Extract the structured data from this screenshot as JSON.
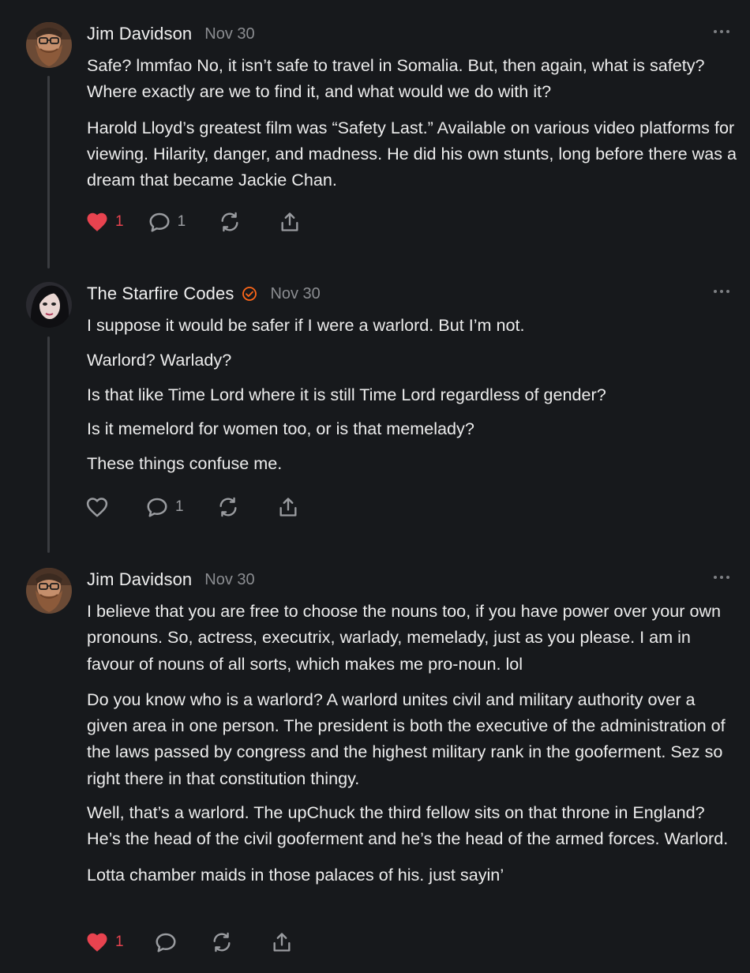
{
  "comments": [
    {
      "author": "Jim Davidson",
      "date": "Nov 30",
      "avatar": "bearded-man-avatar",
      "verified": false,
      "paragraphs": [
        "Safe? lmmfao No, it isn’t safe to travel in Somalia. But, then again, what is safety? Where exactly are we to find it, and what would we do with it?",
        "Harold Lloyd’s greatest film was “Safety Last.” Available on various video platforms for viewing. Hilarity, danger, and madness. He did his own stunts, long before there was a dream that became Jackie Chan."
      ],
      "like_count": "1",
      "liked": true,
      "reply_count": "1"
    },
    {
      "author": "The Starfire Codes",
      "date": "Nov 30",
      "avatar": "woman-avatar",
      "verified": true,
      "paragraphs": [
        "I suppose it would be safer if I were a warlord. But I’m not.",
        "Warlord? Warlady?",
        "Is that like Time Lord where it is still Time Lord regardless of gender?",
        "Is it memelord for women too, or is that memelady?",
        "These things confuse me."
      ],
      "like_count": "",
      "liked": false,
      "reply_count": "1"
    },
    {
      "author": "Jim Davidson",
      "date": "Nov 30",
      "avatar": "bearded-man-avatar",
      "verified": false,
      "paragraphs": [
        "I believe that you are free to choose the nouns too, if you have power over your own pronouns. So, actress, executrix, warlady, memelady, just as you please. I am in favour of nouns of all sorts, which makes me pro-noun. lol",
        "Do you know who is a warlord? A warlord unites civil and military authority over a given area in one person. The president is both the executive of the administration of the laws passed by congress and the highest military rank in the gooferment. Sez so right there in that constitution thingy.",
        "Well, that’s a warlord. The upChuck the third fellow sits on that throne in England? He’s the head of the civil gooferment and he’s the head of the armed forces. Warlord.",
        "Lotta chamber maids in those palaces of his. just sayin’"
      ],
      "like_count": "1",
      "liked": true,
      "reply_count": ""
    }
  ],
  "colors": {
    "background": "#17191c",
    "text": "#ececec",
    "muted": "#8b8d91",
    "like_red": "#e8434f",
    "verified_orange": "#ff6719",
    "thread_line": "#3a3c40"
  },
  "icons": {
    "like": "heart-icon",
    "reply": "comment-bubble-icon",
    "restack": "restack-icon",
    "share": "share-icon",
    "more": "more-options-icon",
    "verified": "verified-badge-icon"
  }
}
